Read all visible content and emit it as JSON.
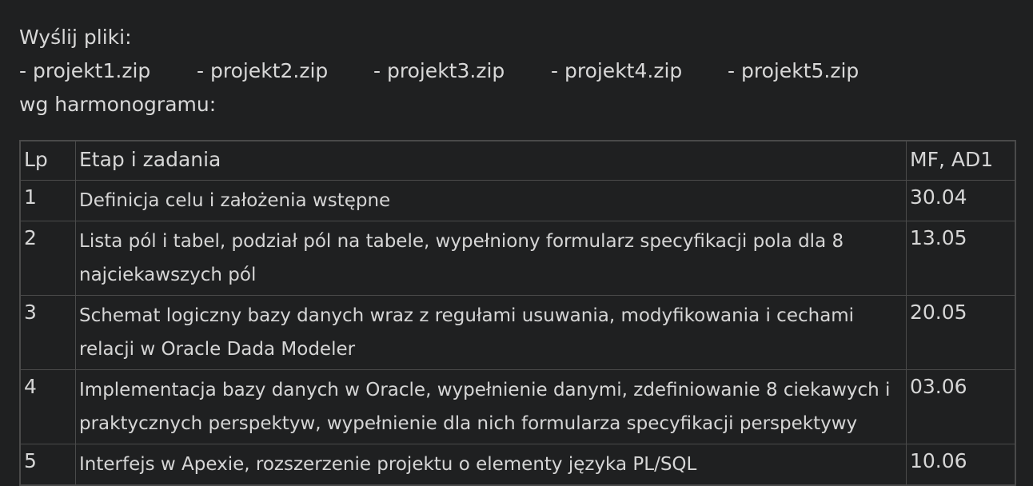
{
  "intro": {
    "line1": "Wyślij pliki:",
    "files": [
      "- projekt1.zip",
      "- projekt2.zip",
      "- projekt3.zip",
      "- projekt4.zip",
      "- projekt5.zip"
    ],
    "line3": "wg harmonogramu:"
  },
  "table": {
    "headers": {
      "lp": "Lp",
      "task": "Etap i zadania",
      "date": "MF, AD1"
    },
    "rows": [
      {
        "lp": "1",
        "task": "Definicja celu i założenia wstępne",
        "date": "30.04"
      },
      {
        "lp": "2",
        "task": "Lista pól i tabel, podział pól na tabele, wypełniony formularz specyfikacji pola dla 8 najciekawszych pól",
        "date": "13.05"
      },
      {
        "lp": "3",
        "task": "Schemat logiczny bazy danych wraz z regułami usuwania, modyfikowania i cechami relacji w Oracle Dada Modeler",
        "date": "20.05"
      },
      {
        "lp": "4",
        "task": "Implementacja bazy danych w Oracle, wypełnienie danymi, zdefiniowanie 8 ciekawych i praktycznych perspektyw, wypełnienie dla nich formularza specyfikacji perspektywy",
        "date": "03.06"
      },
      {
        "lp": "5",
        "task": "Interfejs w Apexie, rozszerzenie projektu o elementy języka PL/SQL",
        "date": "10.06"
      }
    ]
  },
  "colors": {
    "background": "#1f2021",
    "text": "#d6d6d6",
    "border": "#4a4a4a"
  }
}
